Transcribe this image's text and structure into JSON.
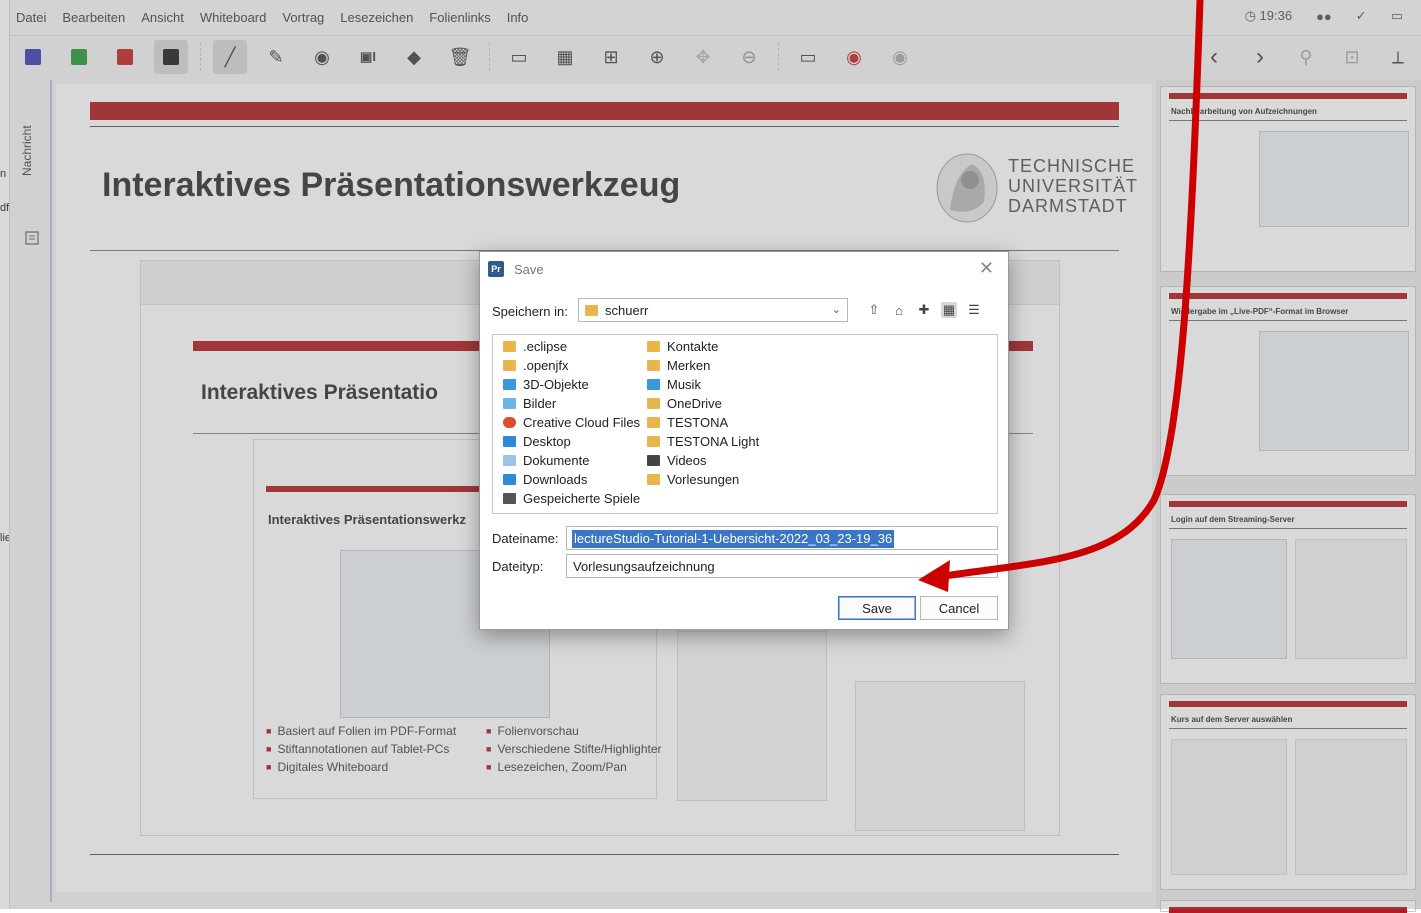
{
  "left_window": {
    "fragments": [
      "n",
      "df",
      "lie"
    ]
  },
  "menubar": {
    "items": [
      "Datei",
      "Bearbeiten",
      "Ansicht",
      "Whiteboard",
      "Vortrag",
      "Lesezeichen",
      "Folienlinks",
      "Info"
    ],
    "time": "19:36"
  },
  "toolbar": {
    "colors": {
      "blue": "#3b3fb5",
      "green": "#2c9a3a",
      "red": "#c62828",
      "black": "#222222"
    }
  },
  "sidetab": {
    "label": "Nachricht"
  },
  "slide": {
    "title": "Interaktives Präsentationswerkzeug",
    "logo_lines": [
      "TECHNISCHE",
      "UNIVERSITÄT",
      "DARMSTADT"
    ],
    "nested_title_1": "Interaktives Präsentatio",
    "nested_title_2": "Interaktives Präsentationswerkz",
    "bullets_left": [
      "Basiert auf Folien im PDF-Format",
      "Stiftannotationen auf Tablet-PCs",
      "Digitales Whiteboard"
    ],
    "bullets_right": [
      "Folienvorschau",
      "Verschiedene Stifte/Highlighter",
      "Lesezeichen, Zoom/Pan"
    ],
    "accent": "#b01e23"
  },
  "thumbnails": [
    {
      "title": "Nachbearbeitung von Aufzeichnungen"
    },
    {
      "title": "Wiedergabe im „Live-PDF“-Format im Browser"
    },
    {
      "title": "Login auf dem Streaming-Server"
    },
    {
      "title": "Kurs auf dem Server auswählen"
    }
  ],
  "dialog": {
    "title": "Save",
    "look_in_label": "Speichern in:",
    "look_in_value": "schuerr",
    "files_col1": [
      ".eclipse",
      ".openjfx",
      "3D-Objekte",
      "Bilder",
      "Creative Cloud Files",
      "Desktop",
      "Dokumente",
      "Downloads",
      "Gespeicherte Spiele"
    ],
    "files_col2": [
      "Kontakte",
      "Merken",
      "Musik",
      "OneDrive",
      "TESTONA",
      "TESTONA Light",
      "Videos",
      "Vorlesungen"
    ],
    "filename_label": "Dateiname:",
    "filename_value": "lectureStudio-Tutorial-1-Uebersicht-2022_03_23-19_36",
    "filetype_label": "Dateityp:",
    "filetype_value": "Vorlesungsaufzeichnung",
    "save_label": "Save",
    "cancel_label": "Cancel"
  },
  "annotation": {
    "arrow_color": "#cc0000"
  }
}
